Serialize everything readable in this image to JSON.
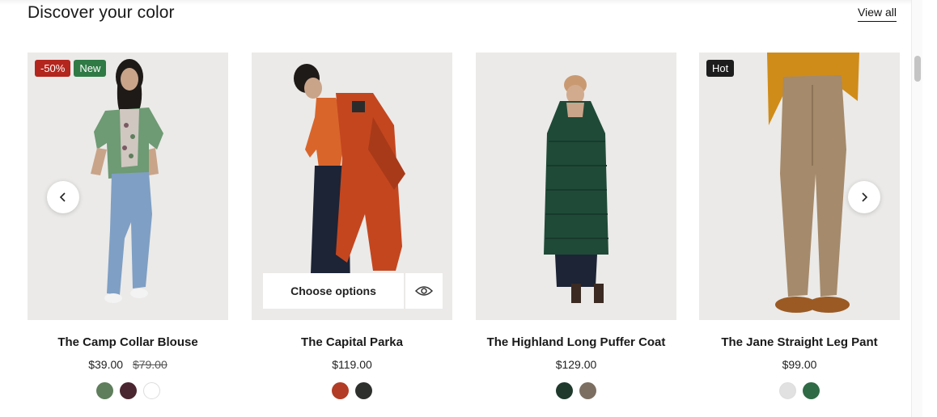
{
  "section": {
    "title": "Discover your color",
    "view_all": "View all"
  },
  "quick_actions": {
    "choose_options": "Choose options"
  },
  "products": [
    {
      "title": "The Camp Collar Blouse",
      "price": "$39.00",
      "compare_price": "$79.00",
      "badges": [
        "-50%",
        "New"
      ],
      "swatches": [
        "#5f7e5c",
        "#4a2630",
        "#ffffff"
      ]
    },
    {
      "title": "The Capital Parka",
      "price": "$119.00",
      "compare_price": "",
      "badges": [],
      "swatches": [
        "#b23c25",
        "#2e302e"
      ]
    },
    {
      "title": "The Highland Long Puffer Coat",
      "price": "$129.00",
      "compare_price": "",
      "badges": [],
      "swatches": [
        "#1f3a2d",
        "#7c6f62"
      ]
    },
    {
      "title": "The Jane Straight Leg Pant",
      "price": "$99.00",
      "compare_price": "",
      "badges": [
        "Hot"
      ],
      "swatches": [
        "#e1e1e1",
        "#2f6b45"
      ]
    }
  ],
  "icons": {
    "prev": "chevron-left-icon",
    "next": "chevron-right-icon",
    "quick_view": "eye-icon"
  },
  "colors": {
    "sale_badge": "#b3261e",
    "new_badge": "#2f7a45",
    "hot_badge": "#1d1d1d"
  }
}
